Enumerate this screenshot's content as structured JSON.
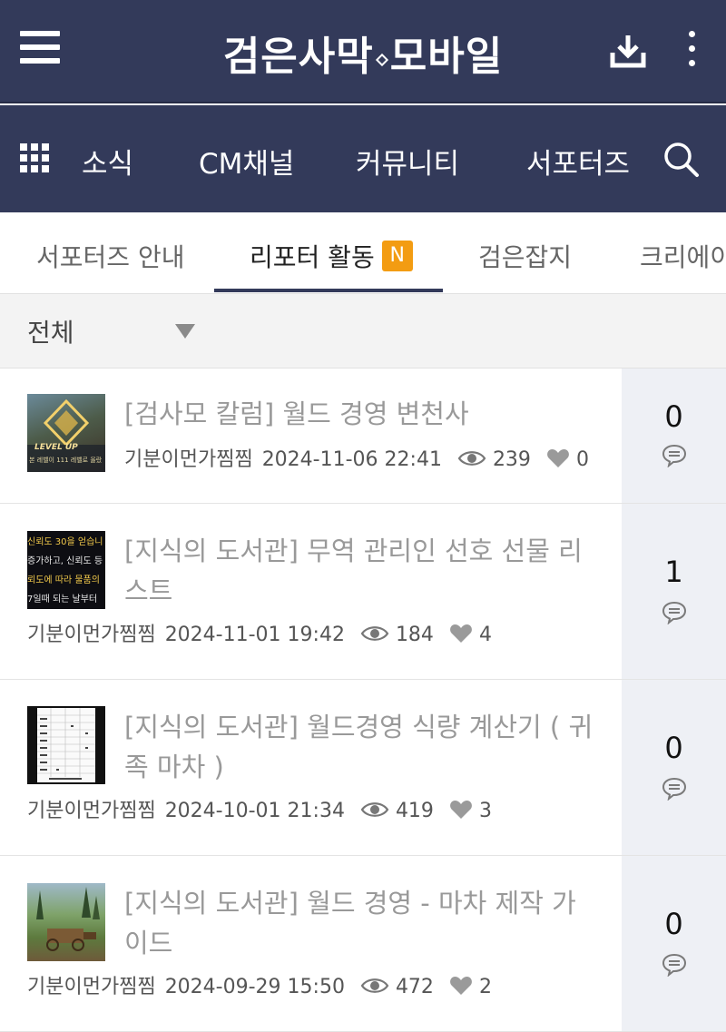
{
  "header": {
    "logo_left": "검은사막",
    "logo_right": "모바일",
    "colors": {
      "bar": "#333a5a",
      "accent": "#f39c12"
    }
  },
  "nav": {
    "items": [
      "소식",
      "CM채널",
      "커뮤니티",
      "서포터즈"
    ]
  },
  "tabs": {
    "items": [
      {
        "label": "서포터즈 안내"
      },
      {
        "label": "리포터 활동",
        "badge": "N",
        "active": true
      },
      {
        "label": "검은잡지"
      },
      {
        "label": "크리에이"
      }
    ]
  },
  "filter": {
    "selected": "전체"
  },
  "posts": [
    {
      "title": "[검사모 칼럼] 월드 경영 변천사",
      "author": "기분이먼가찜찜",
      "date": "2024-11-06 22:41",
      "views": "239",
      "likes": "0",
      "comments": "0",
      "thumb_text": [
        "LEVEL UP",
        "본 레벨이 111 레벨로 올랐"
      ]
    },
    {
      "title": "[지식의 도서관] 무역 관리인 선호 선물 리스트",
      "author": "기분이먼가찜찜",
      "date": "2024-11-01 19:42",
      "views": "184",
      "likes": "4",
      "comments": "1",
      "thumb_text": [
        "신뢰도 30을 얻습니",
        "증가하고, 신뢰도 등",
        "뢰도에 따라 물품의",
        "7일때 되는 날부터"
      ]
    },
    {
      "title": "[지식의 도서관] 월드경영 식량 계산기 ( 귀족 마차 )",
      "author": "기분이먼가찜찜",
      "date": "2024-10-01 21:34",
      "views": "419",
      "likes": "3",
      "comments": "0",
      "thumb_text": []
    },
    {
      "title": "[지식의 도서관] 월드 경영 - 마차 제작 가이드",
      "author": "기분이먼가찜찜",
      "date": "2024-09-29 15:50",
      "views": "472",
      "likes": "2",
      "comments": "0",
      "thumb_text": []
    }
  ]
}
